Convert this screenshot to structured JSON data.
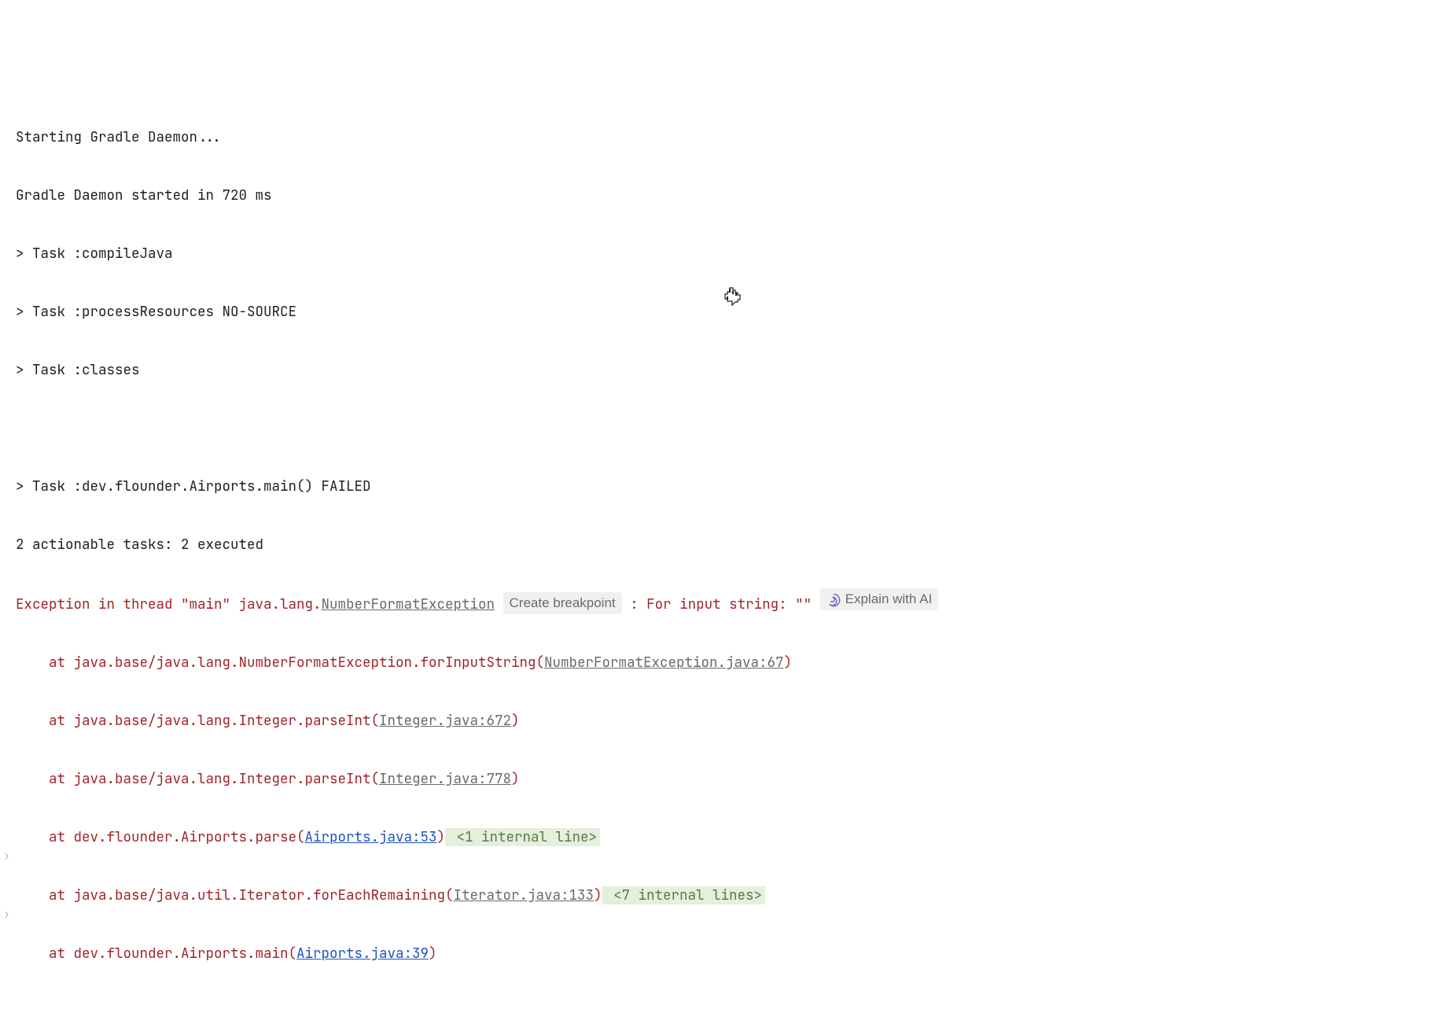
{
  "lines": {
    "l0": "Starting Gradle Daemon...",
    "l1": "Gradle Daemon started in 720 ms",
    "l2": "> Task :compileJava",
    "l3": "> Task :processResources NO-SOURCE",
    "l4": "> Task :classes",
    "l5": "",
    "l6": "> Task :dev.flounder.Airports.main() FAILED",
    "l7": "2 actionable tasks: 2 executed"
  },
  "exception": {
    "prefix": "Exception in thread \"main\" java.lang.",
    "class_link": "NumberFormatException",
    "create_bp": "Create breakpoint",
    "mid": " : For input string: \"\"",
    "explain_ai": "Explain with AI"
  },
  "stack": {
    "s0_pre": "    at java.base/java.lang.NumberFormatException.forInputString(",
    "s0_link": "NumberFormatException.java:67",
    "s0_post": ")",
    "s1_pre": "    at java.base/java.lang.Integer.parseInt(",
    "s1_link": "Integer.java:672",
    "s1_post": ")",
    "s2_pre": "    at java.base/java.lang.Integer.parseInt(",
    "s2_link": "Integer.java:778",
    "s2_post": ")",
    "s3_pre": "    at dev.flounder.Airports.parse(",
    "s3_link": "Airports.java:53",
    "s3_post": ")",
    "s3_internal": " <1 internal line>",
    "s4_pre": "    at java.base/java.util.Iterator.forEachRemaining(",
    "s4_link": "Iterator.java:133",
    "s4_post": ")",
    "s4_internal": " <7 internal lines>",
    "s5_pre": "    at dev.flounder.Airports.main(",
    "s5_link": "Airports.java:39",
    "s5_post": ")"
  },
  "fold": {
    "marker": "›"
  }
}
